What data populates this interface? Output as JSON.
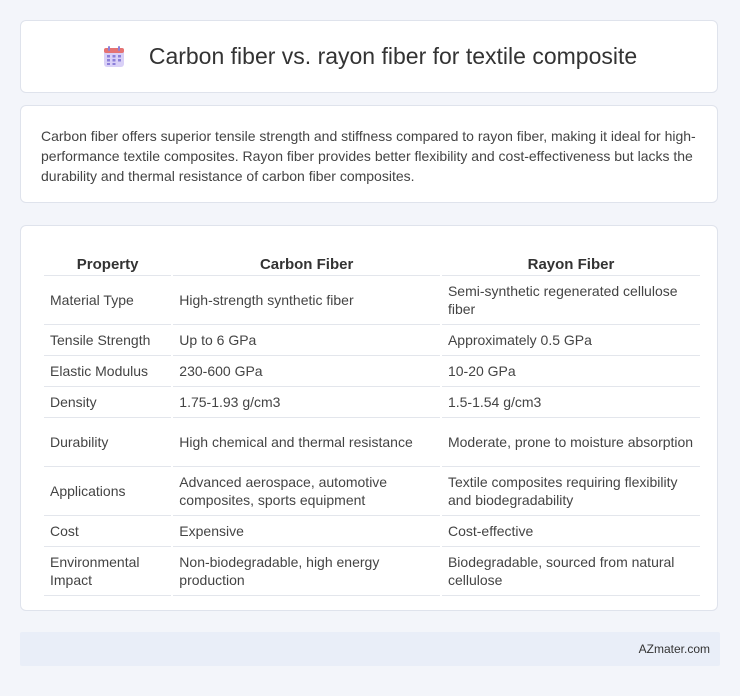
{
  "header": {
    "title": "Carbon fiber vs. rayon fiber for textile composite",
    "icon": "calendar-icon",
    "icon_colors": {
      "top": "#e57373",
      "body": "#c5b9f0",
      "grid": "#8c7fd9"
    }
  },
  "summary": {
    "text": "Carbon fiber offers superior tensile strength and stiffness compared to rayon fiber, making it ideal for high-performance textile composites. Rayon fiber provides better flexibility and cost-effectiveness but lacks the durability and thermal resistance of carbon fiber composites."
  },
  "table": {
    "headers": [
      "Property",
      "Carbon Fiber",
      "Rayon Fiber"
    ],
    "rows": [
      [
        "Material Type",
        "High-strength synthetic fiber",
        "Semi-synthetic regenerated cellulose fiber"
      ],
      [
        "Tensile Strength",
        "Up to 6 GPa",
        "Approximately 0.5 GPa"
      ],
      [
        "Elastic Modulus",
        "230-600 GPa",
        "10-20 GPa"
      ],
      [
        "Density",
        "1.75-1.93 g/cm3",
        "1.5-1.54 g/cm3"
      ],
      [
        "Durability",
        "High chemical and thermal resistance",
        "Moderate, prone to moisture absorption"
      ],
      [
        "Applications",
        "Advanced aerospace, automotive composites, sports equipment",
        "Textile composites requiring flexibility and biodegradability"
      ],
      [
        "Cost",
        "Expensive",
        "Cost-effective"
      ],
      [
        "Environmental Impact",
        "Non-biodegradable, high energy production",
        "Biodegradable, sourced from natural cellulose"
      ]
    ]
  },
  "footer": {
    "brand": "AZmater.com"
  }
}
